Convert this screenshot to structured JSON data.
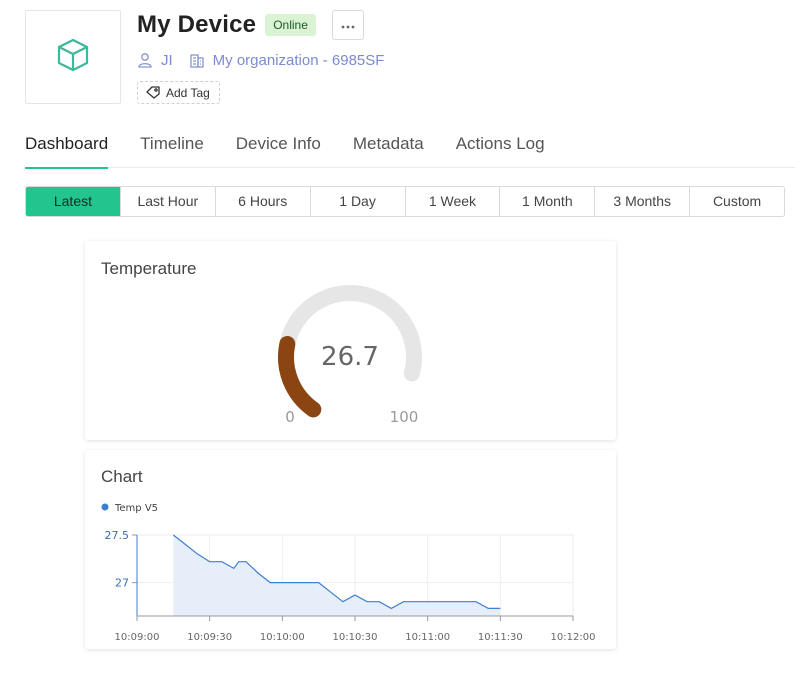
{
  "device": {
    "title": "My Device",
    "status": "Online",
    "owner": "JI",
    "organization": "My organization - 6985SF",
    "add_tag_label": "Add Tag"
  },
  "tabs": [
    "Dashboard",
    "Timeline",
    "Device Info",
    "Metadata",
    "Actions Log"
  ],
  "time_ranges": [
    "Latest",
    "Last Hour",
    "6 Hours",
    "1 Day",
    "1 Week",
    "1 Month",
    "3 Months",
    "Custom"
  ],
  "active_range": "Latest",
  "colors": {
    "accent": "#23c48e",
    "status_bg": "#d9f3d3",
    "gauge_fill": "#8b4513",
    "gauge_track": "#e6e6e6",
    "series_line": "#3d7fd1",
    "series_fill": "#e6eefa",
    "link": "#7b8bd0"
  },
  "icons": {
    "device": "cube-icon",
    "owner": "user-icon",
    "organization": "building-icon",
    "tag": "tag-icon",
    "more": "more-dots-icon"
  },
  "widgets": {
    "gauge": {
      "title": "Temperature",
      "value": "26.7",
      "min": "0",
      "max": "100"
    },
    "chart": {
      "title": "Chart"
    }
  },
  "chart_data": {
    "type": "area",
    "title": "Chart",
    "legend": "top-left",
    "grid": true,
    "ylim": [
      26.65,
      27.5
    ],
    "x_ticks": [
      "10:09:00",
      "10:09:30",
      "10:10:00",
      "10:10:30",
      "10:11:00",
      "10:11:30",
      "10:12:00"
    ],
    "y_ticks": [
      "27.5",
      "27"
    ],
    "series": [
      {
        "name": "Temp V5",
        "x": [
          "10:09:15",
          "10:09:20",
          "10:09:25",
          "10:09:30",
          "10:09:35",
          "10:09:40",
          "10:09:42",
          "10:09:45",
          "10:09:50",
          "10:09:55",
          "10:10:00",
          "10:10:05",
          "10:10:10",
          "10:10:15",
          "10:10:20",
          "10:10:25",
          "10:10:30",
          "10:10:35",
          "10:10:40",
          "10:10:45",
          "10:10:50",
          "10:10:55",
          "10:11:00",
          "10:11:05",
          "10:11:10",
          "10:11:15",
          "10:11:20",
          "10:11:25",
          "10:11:30"
        ],
        "y": [
          27.5,
          27.4,
          27.3,
          27.22,
          27.22,
          27.15,
          27.22,
          27.22,
          27.1,
          27.0,
          27.0,
          27.0,
          27.0,
          27.0,
          26.9,
          26.8,
          26.87,
          26.8,
          26.8,
          26.73,
          26.8,
          26.8,
          26.8,
          26.8,
          26.8,
          26.8,
          26.8,
          26.73,
          26.73
        ]
      }
    ]
  }
}
